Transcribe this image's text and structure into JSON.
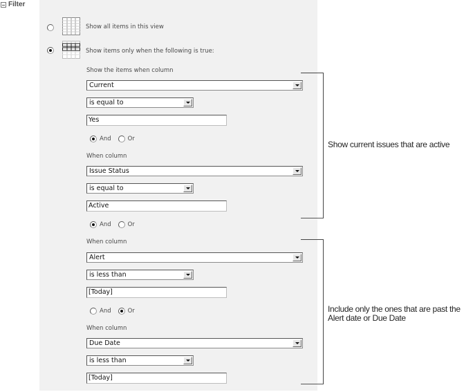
{
  "section": {
    "title": "Filter",
    "collapse_icon": "collapse-minus-icon"
  },
  "view_options": [
    {
      "label": "Show all items in this view",
      "selected": false,
      "icon": "table-grid-icon"
    },
    {
      "label": "Show items only when the following is true:",
      "selected": true,
      "icon": "table-filtered-grid-icon"
    }
  ],
  "filter": {
    "first_label": "Show the items when column",
    "when_label": "When column",
    "and_label": "And",
    "or_label": "Or",
    "conditions": [
      {
        "column": "Current",
        "operator": "is equal to",
        "value": "Yes",
        "join": "And"
      },
      {
        "column": "Issue Status",
        "operator": "is equal to",
        "value": "Active",
        "join": "And"
      },
      {
        "column": "Alert",
        "operator": "is less than",
        "value": "[Today]",
        "join": "Or"
      },
      {
        "column": "Due Date",
        "operator": "is less than",
        "value": "[Today]",
        "join": null
      }
    ]
  },
  "annotations": [
    {
      "text": "Show current issues that are active"
    },
    {
      "line1": "Include only the ones that are past the",
      "line2": "Alert date or Due Date"
    }
  ]
}
